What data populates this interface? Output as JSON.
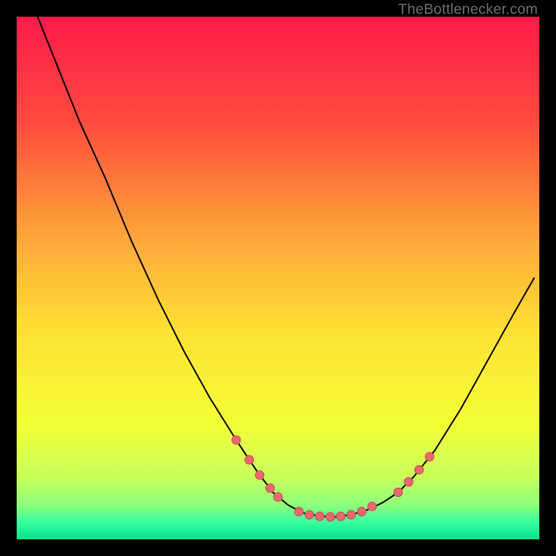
{
  "watermark": "TheBottlenecker.com",
  "chart_data": {
    "type": "line",
    "title": "",
    "xlabel": "",
    "ylabel": "",
    "xlim": [
      0,
      100
    ],
    "ylim": [
      0,
      100
    ],
    "gradient_stops": [
      {
        "offset": 0,
        "color": "#ff1a4b"
      },
      {
        "offset": 0.2,
        "color": "#ff4a3e"
      },
      {
        "offset": 0.42,
        "color": "#ffa53a"
      },
      {
        "offset": 0.6,
        "color": "#ffe033"
      },
      {
        "offset": 0.78,
        "color": "#f2ff36"
      },
      {
        "offset": 0.88,
        "color": "#c8ff5a"
      },
      {
        "offset": 0.935,
        "color": "#8dff7a"
      },
      {
        "offset": 0.965,
        "color": "#3effa0"
      },
      {
        "offset": 1.0,
        "color": "#00e58c"
      }
    ],
    "curve": [
      {
        "x": 4.0,
        "y": 100.0
      },
      {
        "x": 8.0,
        "y": 90.0
      },
      {
        "x": 12.0,
        "y": 80.0
      },
      {
        "x": 17.0,
        "y": 69.0
      },
      {
        "x": 22.0,
        "y": 57.0
      },
      {
        "x": 27.0,
        "y": 46.0
      },
      {
        "x": 32.0,
        "y": 36.0
      },
      {
        "x": 37.0,
        "y": 27.0
      },
      {
        "x": 42.0,
        "y": 19.0
      },
      {
        "x": 46.0,
        "y": 13.0
      },
      {
        "x": 49.0,
        "y": 9.0
      },
      {
        "x": 52.0,
        "y": 6.5
      },
      {
        "x": 55.0,
        "y": 5.0
      },
      {
        "x": 58.0,
        "y": 4.4
      },
      {
        "x": 61.0,
        "y": 4.3
      },
      {
        "x": 64.0,
        "y": 4.7
      },
      {
        "x": 67.0,
        "y": 5.6
      },
      {
        "x": 70.0,
        "y": 7.0
      },
      {
        "x": 73.0,
        "y": 9.0
      },
      {
        "x": 76.0,
        "y": 12.0
      },
      {
        "x": 80.0,
        "y": 17.0
      },
      {
        "x": 85.0,
        "y": 25.0
      },
      {
        "x": 90.0,
        "y": 34.0
      },
      {
        "x": 95.0,
        "y": 43.0
      },
      {
        "x": 99.0,
        "y": 50.0
      }
    ],
    "markers": [
      {
        "x": 42.0,
        "y": 19.0
      },
      {
        "x": 44.5,
        "y": 15.2
      },
      {
        "x": 46.5,
        "y": 12.3
      },
      {
        "x": 48.5,
        "y": 9.8
      },
      {
        "x": 50.0,
        "y": 8.1
      },
      {
        "x": 54.0,
        "y": 5.3
      },
      {
        "x": 56.0,
        "y": 4.7
      },
      {
        "x": 58.0,
        "y": 4.4
      },
      {
        "x": 60.0,
        "y": 4.3
      },
      {
        "x": 62.0,
        "y": 4.4
      },
      {
        "x": 64.0,
        "y": 4.7
      },
      {
        "x": 66.0,
        "y": 5.3
      },
      {
        "x": 68.0,
        "y": 6.3
      },
      {
        "x": 73.0,
        "y": 9.0
      },
      {
        "x": 75.0,
        "y": 11.0
      },
      {
        "x": 77.0,
        "y": 13.3
      },
      {
        "x": 79.0,
        "y": 15.8
      }
    ],
    "marker_style": {
      "radius": 6.2,
      "fill": "#e46a6f",
      "stroke": "#d24a52",
      "stroke_width": 1.2
    },
    "line_style": {
      "stroke": "#000000",
      "stroke_width": 2.1
    }
  }
}
